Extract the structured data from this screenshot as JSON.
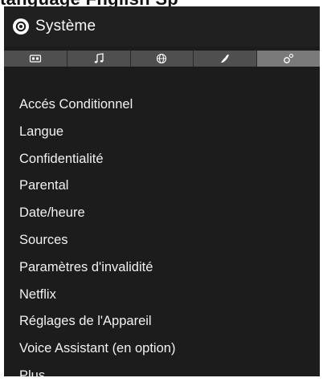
{
  "top_partial_text": "tanguage Fnglish Sp",
  "header": {
    "title": "Système",
    "icon": "gear-icon"
  },
  "tabs": [
    {
      "name": "picture-tab",
      "icon": "screen-icon",
      "active": false
    },
    {
      "name": "sound-tab",
      "icon": "music-note-icon",
      "active": false
    },
    {
      "name": "network-tab",
      "icon": "globe-icon",
      "active": false
    },
    {
      "name": "installation-tab",
      "icon": "satellite-dish-icon",
      "active": false
    },
    {
      "name": "system-tab",
      "icon": "gears-icon",
      "active": true
    }
  ],
  "menu": {
    "items": [
      "Accés Conditionnel",
      "Langue",
      "Confidentialité",
      "Parental",
      "Date/heure",
      "Sources",
      "Paramètres d'invalidité",
      "Netflix",
      "Réglages de l'Appareil",
      "Voice Assistant (en option)",
      "Plus..."
    ]
  },
  "colors": {
    "panel_bg": "#1c1c1c",
    "tab_bg": "#4f4f4f",
    "tab_active": "#7a7a7a",
    "text": "#f1f1f1"
  }
}
